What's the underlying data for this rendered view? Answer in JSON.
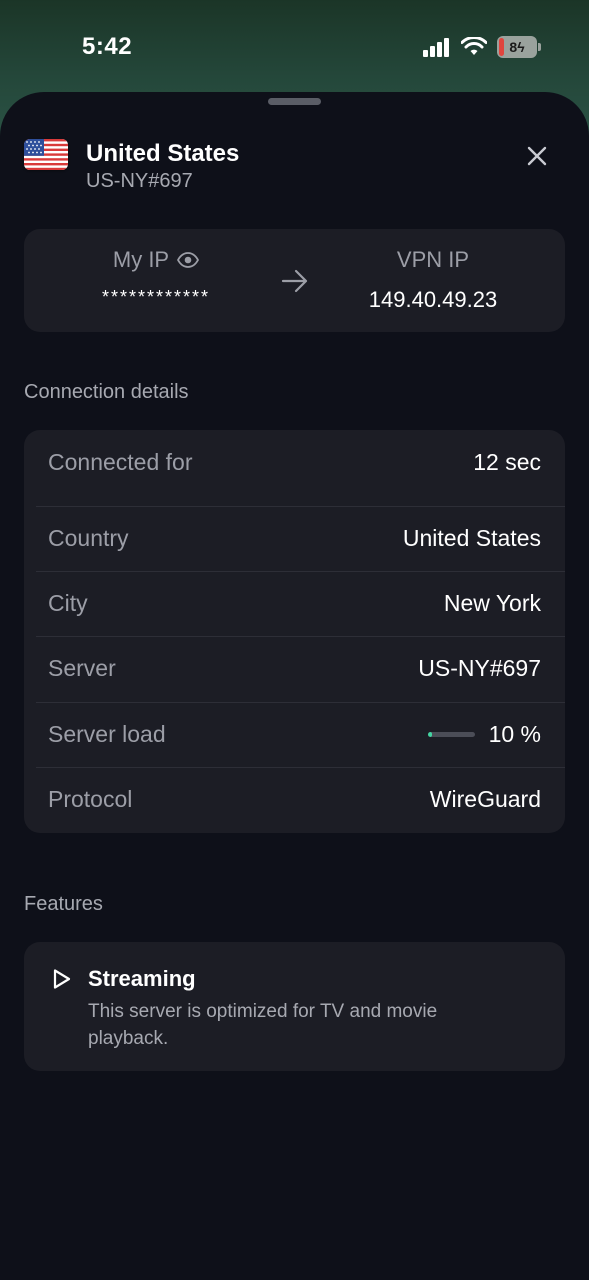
{
  "status_bar": {
    "time": "5:42",
    "battery": "8"
  },
  "header": {
    "country": "United States",
    "server": "US-NY#697"
  },
  "ip": {
    "my_ip_label": "My IP",
    "my_ip_value": "************",
    "vpn_ip_label": "VPN IP",
    "vpn_ip_value": "149.40.49.23"
  },
  "connection": {
    "section_title": "Connection details",
    "rows": [
      {
        "label": "Connected for",
        "value": "12 sec"
      },
      {
        "label": "Country",
        "value": "United States"
      },
      {
        "label": "City",
        "value": "New York"
      },
      {
        "label": "Server",
        "value": "US-NY#697"
      },
      {
        "label": "Server load",
        "value": "10 %",
        "level": 0.1
      },
      {
        "label": "Protocol",
        "value": "WireGuard"
      }
    ]
  },
  "features": {
    "section_title": "Features",
    "items": [
      {
        "title": "Streaming",
        "description": "This server is optimized for TV and movie playback.",
        "icon": "play-icon"
      }
    ]
  },
  "colors": {
    "accent": "#43d6a2",
    "sheet_bg": "#0e1019",
    "card_bg": "#1c1d25"
  }
}
